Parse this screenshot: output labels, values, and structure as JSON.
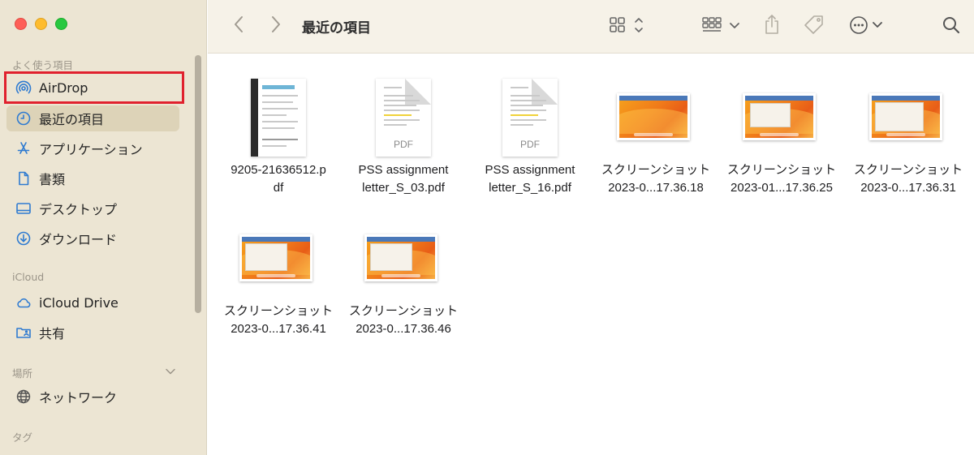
{
  "window": {
    "title": "最近の項目"
  },
  "sidebar": {
    "favorites_title": "よく使う項目",
    "favorites": [
      {
        "label": "AirDrop",
        "icon": "airdrop-icon",
        "highlighted": true
      },
      {
        "label": "最近の項目",
        "icon": "recents-icon",
        "selected": true
      },
      {
        "label": "アプリケーション",
        "icon": "applications-icon"
      },
      {
        "label": "書類",
        "icon": "documents-icon"
      },
      {
        "label": "デスクトップ",
        "icon": "desktop-icon"
      },
      {
        "label": "ダウンロード",
        "icon": "downloads-icon"
      }
    ],
    "icloud_title": "iCloud",
    "icloud": [
      {
        "label": "iCloud Drive",
        "icon": "icloud-icon"
      },
      {
        "label": "共有",
        "icon": "shared-folder-icon"
      }
    ],
    "locations_title": "場所",
    "locations": [
      {
        "label": "ネットワーク",
        "icon": "network-icon"
      }
    ],
    "tags_title": "タグ"
  },
  "files": [
    {
      "name_line1": "9205-21636512.p",
      "name_line2": "df",
      "kind": "scan"
    },
    {
      "name_line1": "PSS assignment",
      "name_line2": "letter_S_03.pdf",
      "kind": "pdf",
      "badge": "PDF"
    },
    {
      "name_line1": "PSS assignment",
      "name_line2": "letter_S_16.pdf",
      "kind": "pdf",
      "badge": "PDF"
    },
    {
      "name_line1": "スクリーンショット",
      "name_line2": "2023-0...17.36.18",
      "kind": "screenshot"
    },
    {
      "name_line1": "スクリーンショット",
      "name_line2": "2023-01...17.36.25",
      "kind": "screenshot"
    },
    {
      "name_line1": "スクリーンショット",
      "name_line2": "2023-0...17.36.31",
      "kind": "screenshot"
    },
    {
      "name_line1": "スクリーンショット",
      "name_line2": "2023-0...17.36.41",
      "kind": "screenshot"
    },
    {
      "name_line1": "スクリーンショット",
      "name_line2": "2023-0...17.36.46",
      "kind": "screenshot"
    }
  ],
  "colors": {
    "sidebar_bg": "#ece5d3",
    "selection": "#ddd3b8",
    "highlight_border": "#e0212e",
    "accent_icon": "#2f7bd1"
  }
}
